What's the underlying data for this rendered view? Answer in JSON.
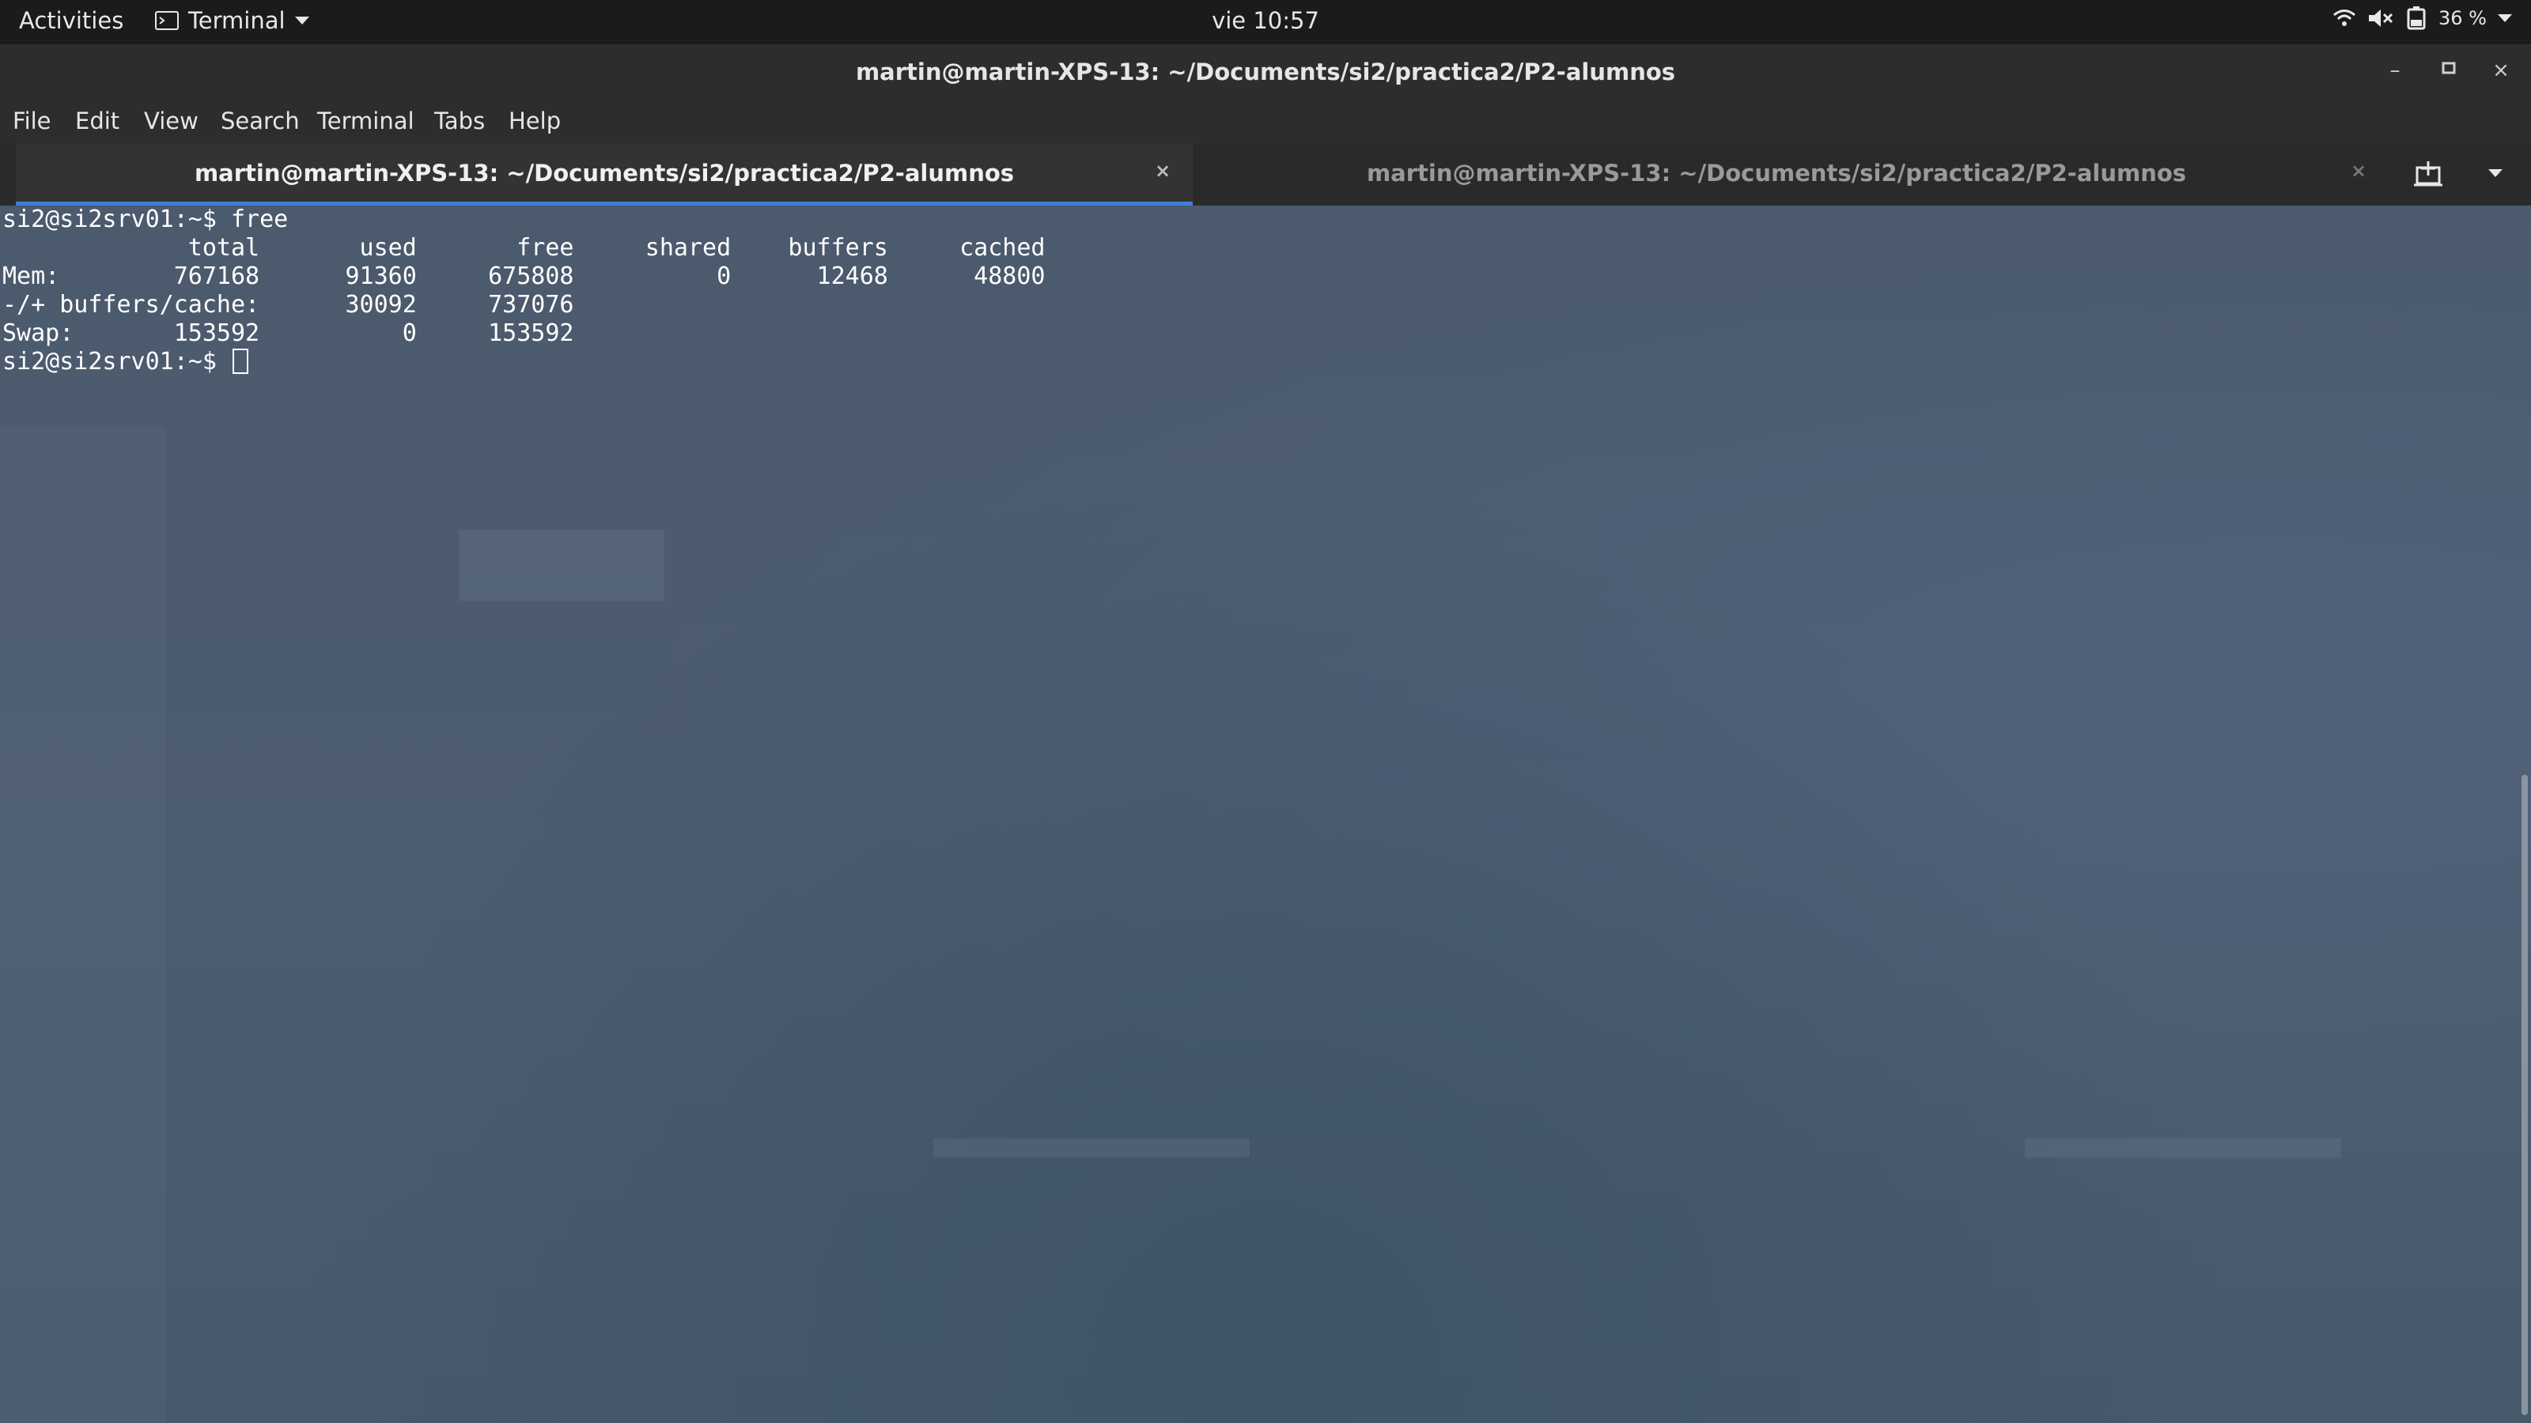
{
  "topbar": {
    "activities": "Activities",
    "app_name": "Terminal",
    "clock": "vie 10:57",
    "battery": "36 %"
  },
  "window": {
    "title": "martin@martin-XPS-13: ~/Documents/si2/practica2/P2-alumnos"
  },
  "menubar": [
    "File",
    "Edit",
    "View",
    "Search",
    "Terminal",
    "Tabs",
    "Help"
  ],
  "tabs": [
    {
      "label": "martin@martin-XPS-13: ~/Documents/si2/practica2/P2-alumnos",
      "close": "×",
      "active": true
    },
    {
      "label": "martin@martin-XPS-13: ~/Documents/si2/practica2/P2-alumnos",
      "close": "×",
      "active": false
    }
  ],
  "terminal": {
    "lines": [
      "si2@si2srv01:~$ free",
      "             total       used       free     shared    buffers     cached",
      "Mem:        767168      91360     675808          0      12468      48800",
      "-/+ buffers/cache:      30092     737076",
      "Swap:       153592          0     153592"
    ],
    "prompt": "si2@si2srv01:~$ "
  },
  "icons": {
    "wifi": "wifi-icon",
    "volume": "volume-muted-icon",
    "battery": "battery-icon",
    "terminal_app": "terminal-icon",
    "new_tab": "new-tab-icon"
  },
  "colors": {
    "accent": "#3d7fd6",
    "terminal_bg": "#4b5a6c"
  }
}
